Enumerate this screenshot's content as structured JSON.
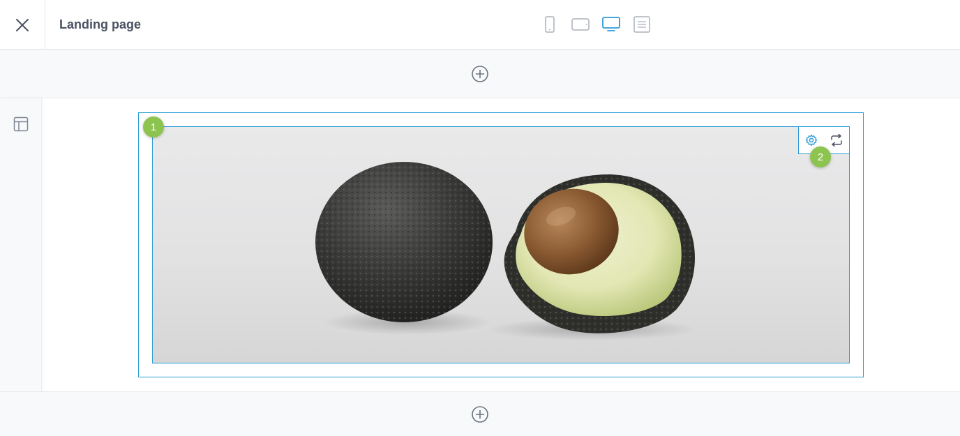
{
  "header": {
    "title": "Landing page",
    "close_icon": "close-icon",
    "devices": [
      {
        "name": "mobile",
        "icon": "smartphone-icon",
        "active": false
      },
      {
        "name": "tablet",
        "icon": "tablet-icon",
        "active": false
      },
      {
        "name": "desktop",
        "icon": "monitor-icon",
        "active": true
      },
      {
        "name": "text",
        "icon": "text-document-icon",
        "active": false
      }
    ]
  },
  "canvas": {
    "image_alt": "Two avocados, one whole and one cut in half with the pit",
    "toolbar": [
      "gear-icon",
      "swap-icon"
    ],
    "badges": {
      "one": "1",
      "two": "2"
    }
  },
  "colors": {
    "accent": "#2b9bd6",
    "badge": "#8dc44f",
    "muted_icon": "#aab0b9",
    "panel_bg": "#f8f9fb"
  }
}
